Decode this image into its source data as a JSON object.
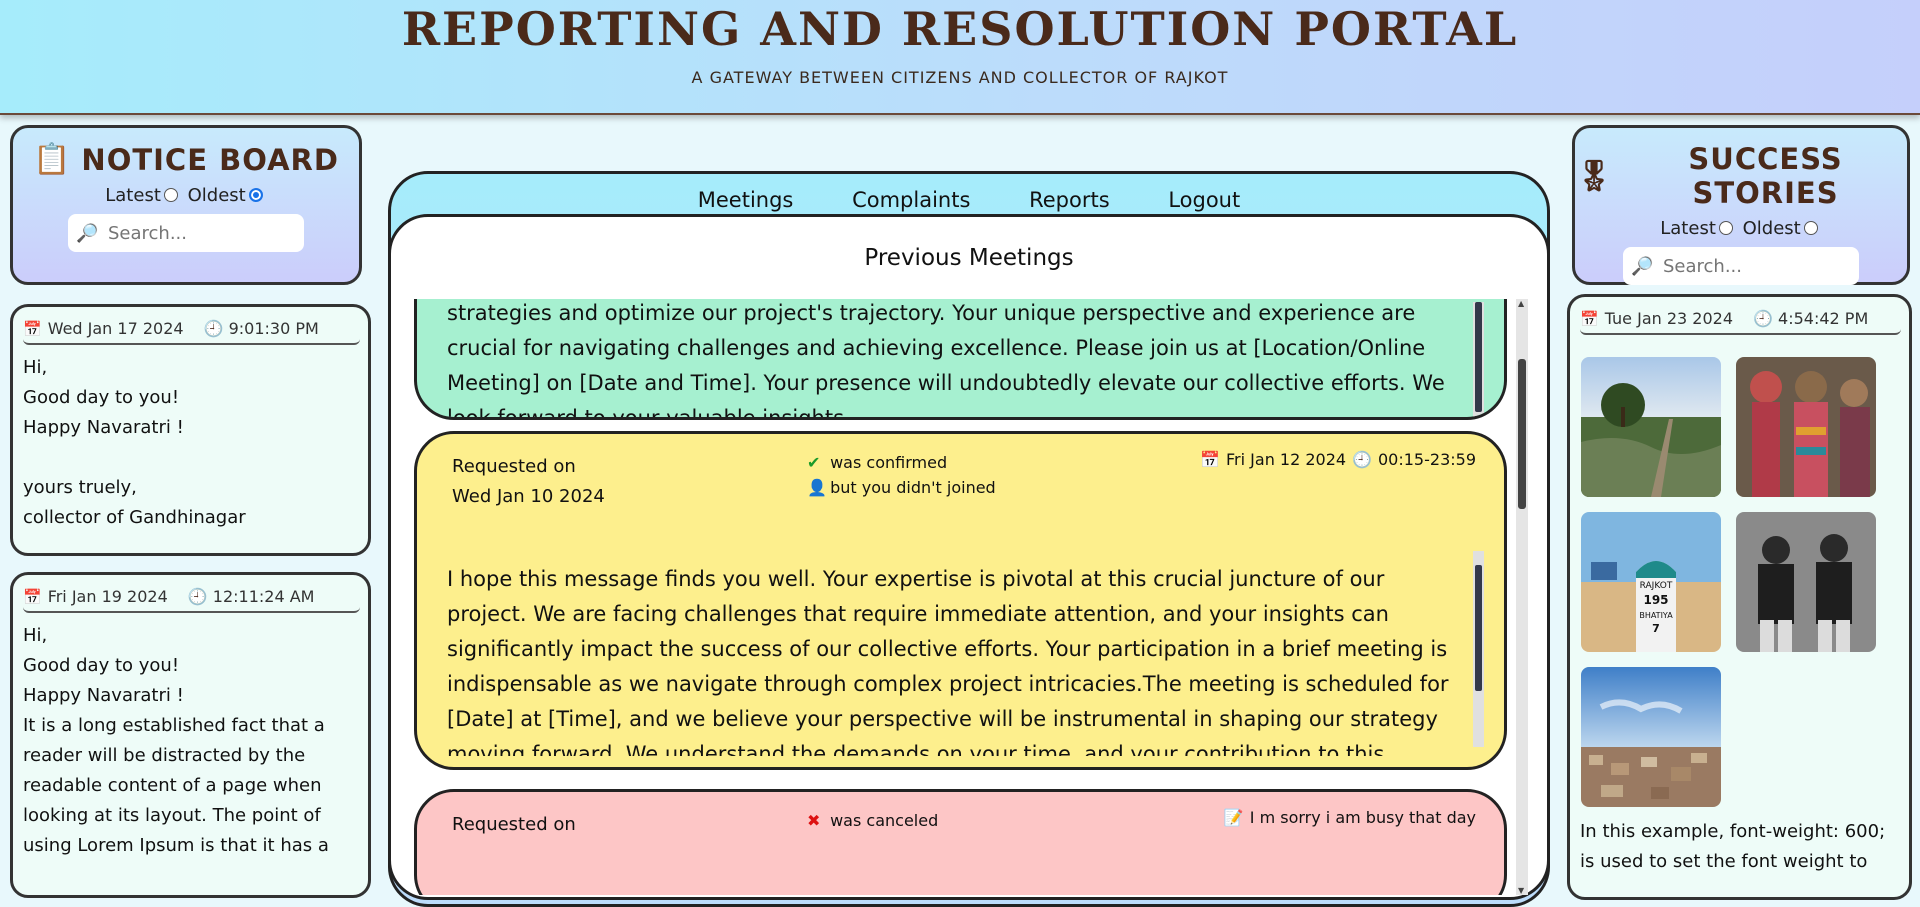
{
  "header": {
    "title": "REPORTING AND RESOLUTION PORTAL",
    "subtitle": "A GATEWAY BETWEEN CITIZENS AND COLLECTOR OF RAJKOT"
  },
  "notice_board": {
    "title": "NOTICE BOARD",
    "icon": "clipboard-icon",
    "sort_latest": "Latest",
    "sort_oldest": "Oldest",
    "selected_sort": "Oldest",
    "search_placeholder": "Search...",
    "cards": [
      {
        "date": "Wed Jan 17 2024",
        "time": "9:01:30 PM",
        "body": "Hi,\nGood day to you!\nHappy Navaratri !\n\nyours truely,\ncollector of Gandhinagar"
      },
      {
        "date": "Fri Jan 19 2024",
        "time": "12:11:24 AM",
        "body": "Hi,\nGood day to you!\nHappy Navaratri !\nIt is a long established fact that a reader will be distracted by the readable content of a page when looking at its layout. The point of using Lorem Ipsum is that it has a"
      }
    ]
  },
  "nav": {
    "meetings": "Meetings",
    "complaints": "Complaints",
    "reports": "Reports",
    "logout": "Logout"
  },
  "main": {
    "section_title": "Previous Meetings",
    "meetings": [
      {
        "text": "strategies and optimize our project's trajectory. Your unique perspective and experience are crucial for navigating challenges and achieving excellence. Please join us at [Location/Online Meeting] on [Date and Time]. Your presence will undoubtedly elevate our collective efforts. We look forward to your valuable insights."
      },
      {
        "requested_label": "Requested on",
        "requested_date": "Wed Jan 10 2024",
        "status": "was confirmed",
        "status_note": "but you didn't joined",
        "date": "Fri Jan 12 2024",
        "time": "00:15-23:59",
        "text": "I hope this message finds you well. Your expertise is pivotal at this crucial juncture of our project. We are facing challenges that require immediate attention, and your insights can significantly impact the success of our collective efforts. Your participation in a brief meeting is indispensable as we navigate through complex project intricacies.The meeting is scheduled for [Date] at [Time], and we believe your perspective will be instrumental in shaping our strategy moving forward. We understand the demands on your time, and your contribution to this discussion is immensely valued. Your unique"
      },
      {
        "requested_label": "Requested on",
        "status": "was canceled",
        "note": "I m sorry i am busy that day"
      }
    ]
  },
  "success_stories": {
    "title": "SUCCESS STORIES",
    "icon": "medal-icon",
    "sort_latest": "Latest",
    "sort_oldest": "Oldest",
    "search_placeholder": "Search...",
    "card": {
      "date": "Tue Jan 23 2024",
      "time": "4:54:42 PM",
      "text": "In this example, font-weight: 600; is used to set the font weight to"
    }
  }
}
